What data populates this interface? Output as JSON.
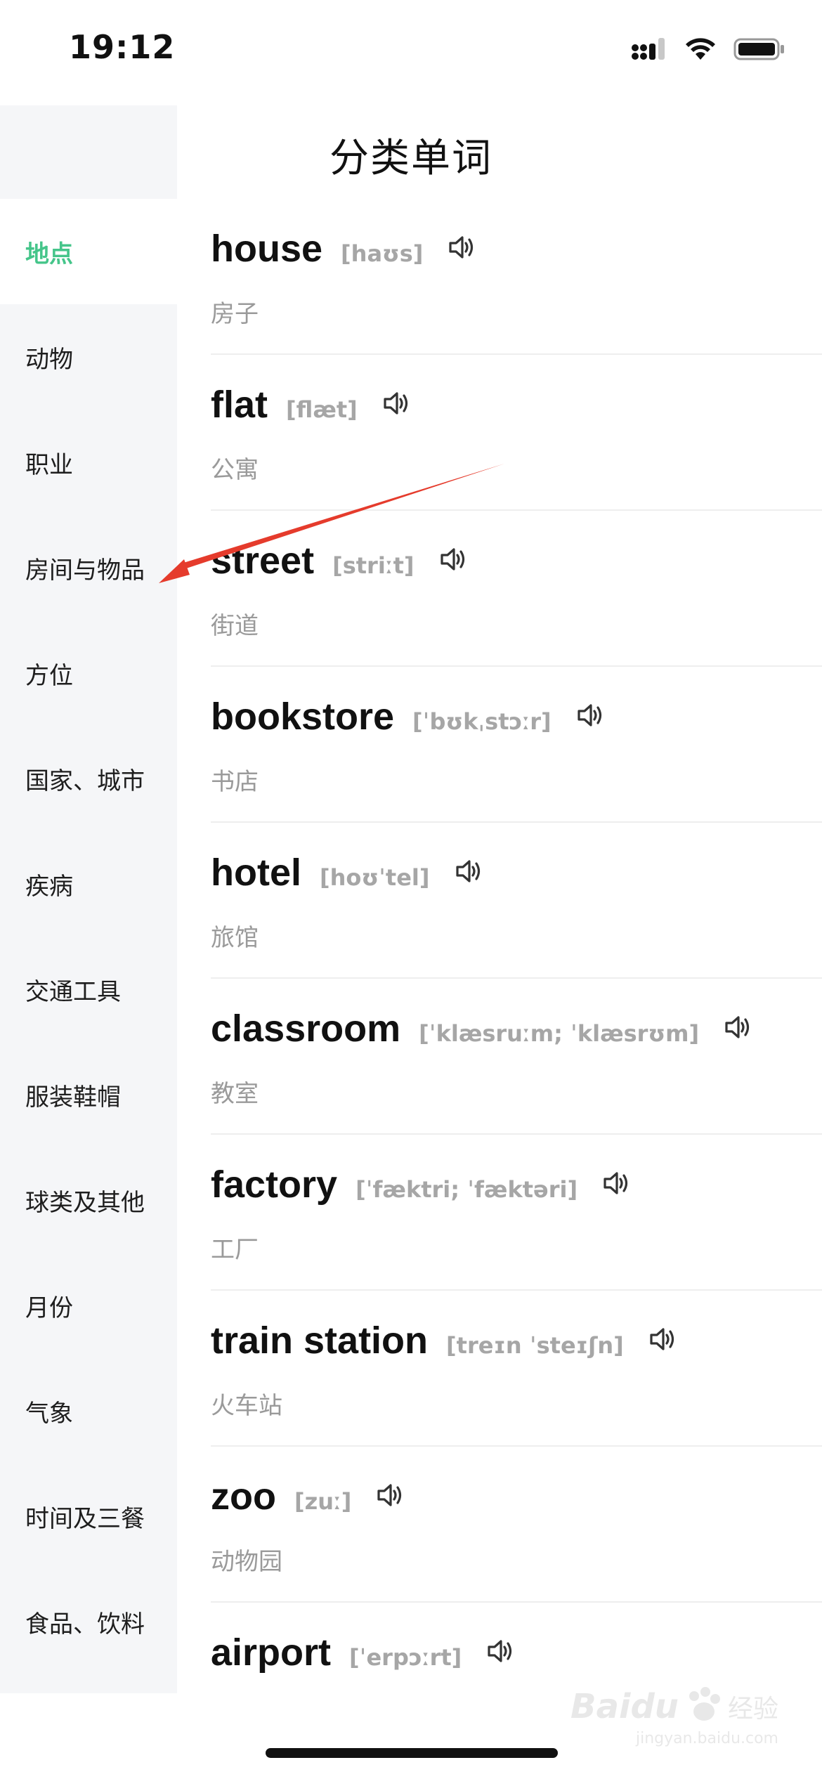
{
  "status_bar": {
    "time": "19:12"
  },
  "nav": {
    "title": "分类单词",
    "back_icon": "chevron-left-icon"
  },
  "sidebar": {
    "active_color": "#45c58a",
    "items": [
      {
        "label": "地点",
        "active": true
      },
      {
        "label": "动物",
        "active": false
      },
      {
        "label": "职业",
        "active": false
      },
      {
        "label": "房间与物品",
        "active": false
      },
      {
        "label": "方位",
        "active": false
      },
      {
        "label": "国家、城市",
        "active": false
      },
      {
        "label": "疾病",
        "active": false
      },
      {
        "label": "交通工具",
        "active": false
      },
      {
        "label": "服装鞋帽",
        "active": false
      },
      {
        "label": "球类及其他",
        "active": false
      },
      {
        "label": "月份",
        "active": false
      },
      {
        "label": "气象",
        "active": false
      },
      {
        "label": "时间及三餐",
        "active": false
      },
      {
        "label": "食品、饮料",
        "active": false
      }
    ]
  },
  "words": [
    {
      "word": "house",
      "phonetic": "[haʊs]",
      "meaning": "房子"
    },
    {
      "word": "flat",
      "phonetic": "[flæt]",
      "meaning": "公寓"
    },
    {
      "word": "street",
      "phonetic": "[striːt]",
      "meaning": "街道"
    },
    {
      "word": "bookstore",
      "phonetic": "[ˈbʊkˌstɔːr]",
      "meaning": "书店"
    },
    {
      "word": "hotel",
      "phonetic": "[hoʊˈtel]",
      "meaning": "旅馆"
    },
    {
      "word": "classroom",
      "phonetic": "[ˈklæsruːm; ˈklæsrʊm]",
      "meaning": "教室"
    },
    {
      "word": "factory",
      "phonetic": "[ˈfæktri; ˈfæktəri]",
      "meaning": "工厂"
    },
    {
      "word": "train station",
      "phonetic": "[treɪn ˈsteɪʃn]",
      "meaning": "火车站"
    },
    {
      "word": "zoo",
      "phonetic": "[zuː]",
      "meaning": "动物园"
    },
    {
      "word": "airport",
      "phonetic": "[ˈerpɔːrt]",
      "meaning": ""
    }
  ],
  "watermark": {
    "brand": "Baidu",
    "cn": "经验",
    "url": "jingyan.baidu.com"
  },
  "colors": {
    "annotation_arrow": "#e53b2c",
    "phonetic": "#a6a6a6",
    "meaning": "#9a9a9a",
    "sidebar_bg": "#f5f6f8"
  }
}
